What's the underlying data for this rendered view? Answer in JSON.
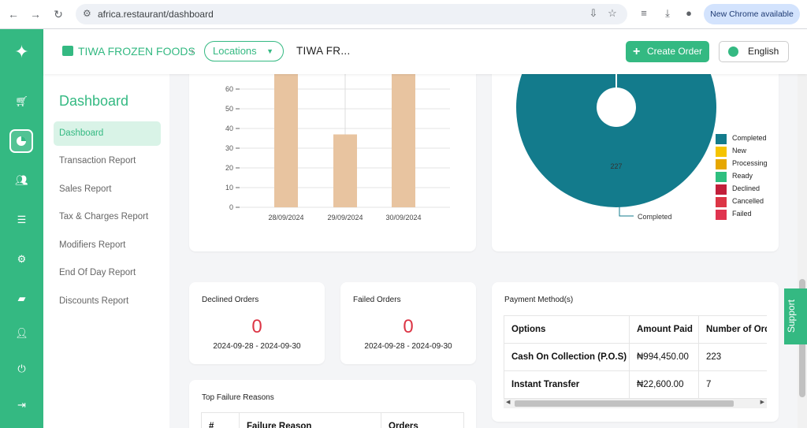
{
  "browser": {
    "url": "africa.restaurant/dashboard",
    "new_chrome": "New Chrome available"
  },
  "header": {
    "brand": "TIWA FROZEN FOODS",
    "location_button": "Locations",
    "current_location": "TIWA FR...",
    "create_order": "Create Order",
    "language": "English"
  },
  "sidebar": {
    "title": "Dashboard",
    "items": [
      {
        "label": "Dashboard",
        "active": true
      },
      {
        "label": "Transaction Report"
      },
      {
        "label": "Sales Report"
      },
      {
        "label": "Tax & Charges Report"
      },
      {
        "label": "Modifiers Report"
      },
      {
        "label": "End Of Day Report"
      },
      {
        "label": "Discounts Report"
      }
    ]
  },
  "chart_data": [
    {
      "type": "bar",
      "categories": [
        "28/09/2024",
        "29/09/2024",
        "30/09/2024"
      ],
      "values": [
        68,
        37,
        68
      ],
      "yticks": [
        "0",
        "10",
        "20",
        "30",
        "40",
        "50",
        "60"
      ],
      "ylim": [
        0,
        70
      ],
      "grid": true,
      "color": "#e8c4a0"
    },
    {
      "type": "pie",
      "slices": [
        {
          "label": "Completed",
          "value": 227,
          "color": "#137b8c"
        }
      ],
      "center_label": "227",
      "callout": "Completed",
      "legend": [
        {
          "label": "Completed",
          "color": "#137b8c"
        },
        {
          "label": "New",
          "color": "#f5c400"
        },
        {
          "label": "Processing",
          "color": "#e6a700"
        },
        {
          "label": "Ready",
          "color": "#2ebf7f"
        },
        {
          "label": "Declined",
          "color": "#c21f3a"
        },
        {
          "label": "Cancelled",
          "color": "#dc3545"
        },
        {
          "label": "Failed",
          "color": "#e0344f"
        }
      ],
      "legend_position": "right"
    }
  ],
  "stats": {
    "declined": {
      "title": "Declined Orders",
      "value": "0",
      "date": "2024-09-28 - 2024-09-30"
    },
    "failed": {
      "title": "Failed Orders",
      "value": "0",
      "date": "2024-09-28 - 2024-09-30"
    }
  },
  "failure_reasons": {
    "title": "Top Failure Reasons",
    "headers": [
      "#",
      "Failure Reason",
      "Orders"
    ]
  },
  "payment_methods": {
    "title": "Payment Method(s)",
    "headers": [
      "Options",
      "Amount Paid",
      "Number of Orders"
    ],
    "rows": [
      [
        "Cash On Collection (P.O.S)",
        "₦994,450.00",
        "223"
      ],
      [
        "Instant Transfer",
        "₦22,600.00",
        "7"
      ]
    ]
  },
  "support": "Support",
  "colors": {
    "accent": "#34b982",
    "danger": "#dc3545"
  }
}
